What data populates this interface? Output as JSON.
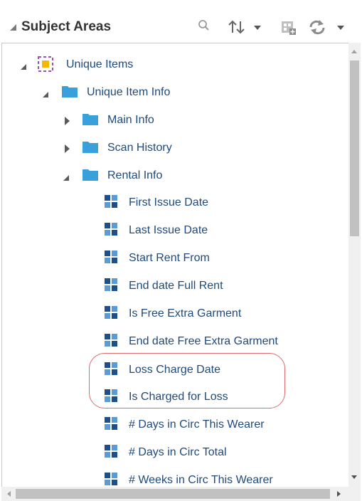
{
  "header": {
    "title": "Subject Areas",
    "icons": [
      "collapse-panel-icon",
      "search-icon",
      "sort-icon",
      "add-subject-area-icon",
      "refresh-icon"
    ]
  },
  "colors": {
    "folder": "#3aa0dc",
    "column_icon_light": "#5b9bd5",
    "column_icon_dark": "#1f4f8a",
    "item_text": "#1f4a7c",
    "subject_area_icon_border": "#9a4fc0",
    "subject_area_icon_fill": "#f5b800",
    "highlight": "#e06a6a"
  },
  "tree": {
    "subject_area": {
      "label": "Unique Items",
      "expanded": true
    },
    "folders": [
      {
        "label": "Unique Item Info",
        "expanded": true
      },
      {
        "label": "Main Info",
        "expanded": false
      },
      {
        "label": "Scan History",
        "expanded": false
      },
      {
        "label": "Rental Info",
        "expanded": true
      }
    ],
    "columns": [
      "First Issue Date",
      "Last Issue Date",
      "Start Rent From",
      "End date Full Rent",
      "Is Free Extra Garment",
      "End date Free Extra Garment",
      "Loss Charge Date",
      "Is Charged for Loss",
      "# Days in Circ This Wearer",
      "# Days in Circ Total",
      "# Weeks in Circ This Wearer"
    ],
    "highlighted_columns": [
      "Loss Charge Date",
      "Is Charged for Loss"
    ]
  }
}
